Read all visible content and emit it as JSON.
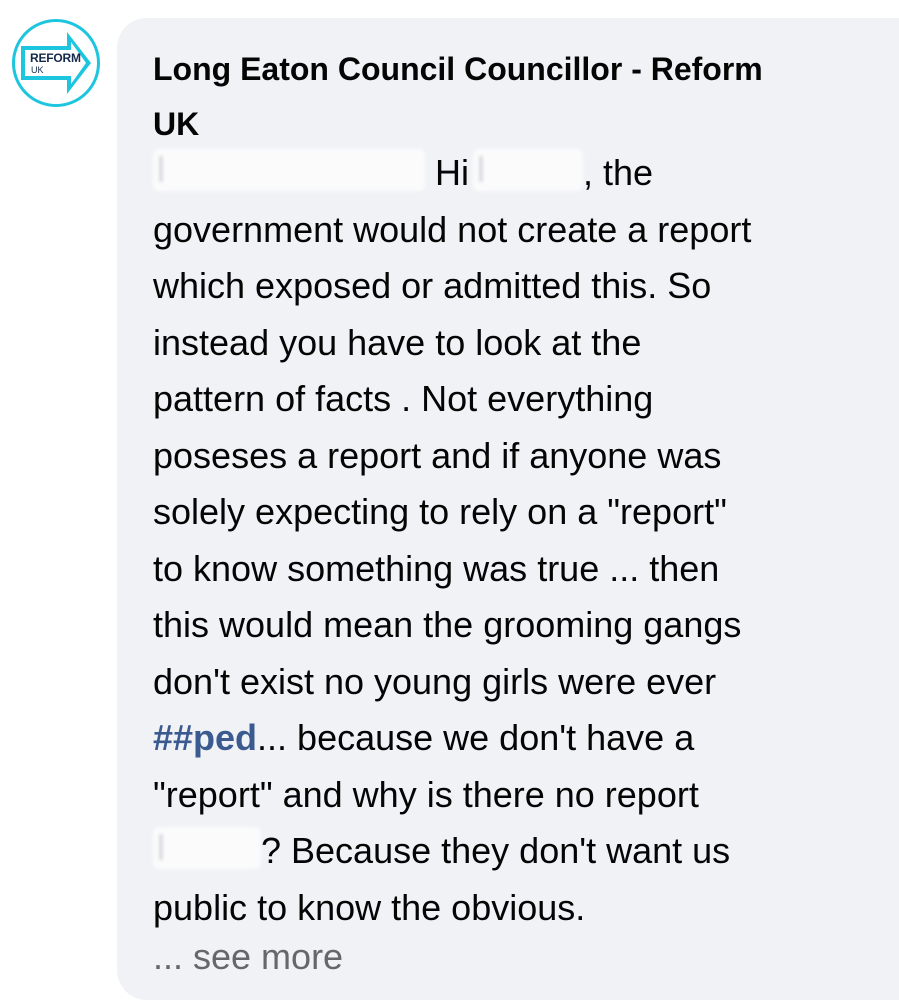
{
  "avatar": {
    "brand": "REFORM",
    "sub": "UK",
    "icon": "arrow-right-icon",
    "ring_color": "#1ec5de",
    "brand_color": "#15294b"
  },
  "comment": {
    "author_line1": "Long Eaton Council Councillor - Reform",
    "author_line2": "UK",
    "lines": {
      "l1_greeting": "Hi",
      "l1_end": ", the",
      "l2": "government would not create a report",
      "l3": "which exposed or admitted this. So",
      "l4": "instead you have to look at the",
      "l5": "pattern of facts . Not everything",
      "l6": "poseses a report and if anyone was",
      "l7": "solely expecting to rely on a \"report\"",
      "l8": "to know something was true  ... then",
      "l9": "this would mean the grooming gangs",
      "l10": "don't exist no young girls were ever",
      "l11_hashtag": "##ped",
      "l11_rest": "... because we don't have a",
      "l12": "\"report\" and why is there no report",
      "l13_rest": "?  Because they don't want us",
      "l14": "public to know the obvious."
    },
    "hashtag_color": "#3b5a8f",
    "see_more": "... see more"
  }
}
